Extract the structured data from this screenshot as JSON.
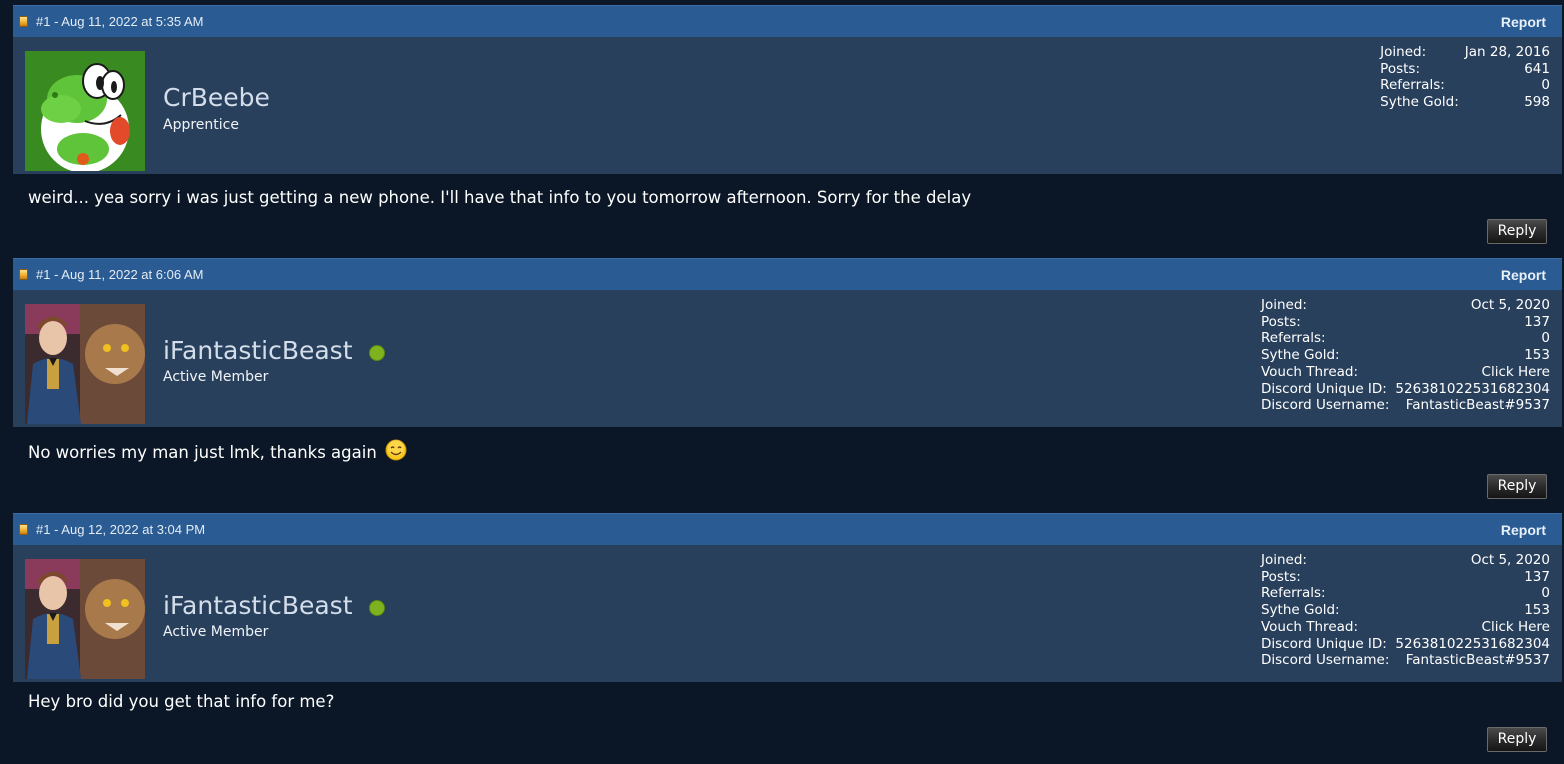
{
  "posts": [
    {
      "header": "#1 - Aug 11, 2022 at 5:35 AM",
      "report_label": "Report",
      "username": "CrBeebe",
      "rank": "Apprentice",
      "online": false,
      "avatar": "yoshi-avatar",
      "stats": [
        {
          "label": "Joined:",
          "value": "Jan 28, 2016"
        },
        {
          "label": "Posts:",
          "value": "641"
        },
        {
          "label": "Referrals:",
          "value": "0"
        },
        {
          "label": "Sythe Gold:",
          "value": "598"
        }
      ],
      "message": "weird... yea sorry i was just getting a new phone. I'll have that info to you tomorrow afternoon. Sorry for the delay",
      "reply_label": "Reply"
    },
    {
      "header": "#1 - Aug 11, 2022 at 6:06 AM",
      "report_label": "Report",
      "username": "iFantasticBeast",
      "rank": "Active Member",
      "online": true,
      "avatar": "fantastic-beasts-avatar",
      "stats": [
        {
          "label": "Joined:",
          "value": "Oct 5, 2020"
        },
        {
          "label": "Posts:",
          "value": "137"
        },
        {
          "label": "Referrals:",
          "value": "0"
        },
        {
          "label": "Sythe Gold:",
          "value": "153"
        },
        {
          "label": "Vouch Thread:",
          "value": "Click Here"
        },
        {
          "label": "Discord Unique ID:",
          "value": "526381022531682304"
        },
        {
          "label": "Discord Username:",
          "value": "FantasticBeast#9537"
        }
      ],
      "message": "No worries my man just lmk, thanks again",
      "message_icon": "smiley-icon",
      "reply_label": "Reply"
    },
    {
      "header": "#1 - Aug 12, 2022 at 3:04 PM",
      "report_label": "Report",
      "username": "iFantasticBeast",
      "rank": "Active Member",
      "online": true,
      "avatar": "fantastic-beasts-avatar",
      "stats": [
        {
          "label": "Joined:",
          "value": "Oct 5, 2020"
        },
        {
          "label": "Posts:",
          "value": "137"
        },
        {
          "label": "Referrals:",
          "value": "0"
        },
        {
          "label": "Sythe Gold:",
          "value": "153"
        },
        {
          "label": "Vouch Thread:",
          "value": "Click Here"
        },
        {
          "label": "Discord Unique ID:",
          "value": "526381022531682304"
        },
        {
          "label": "Discord Username:",
          "value": "FantasticBeast#9537"
        }
      ],
      "message": "Hey bro did you get that info for me?",
      "reply_label": "Reply"
    }
  ],
  "colors": {
    "header_bar": "#2a5b92",
    "user_panel": "#29405d",
    "body_bg": "#0b1726",
    "online": "#7fb21f"
  }
}
